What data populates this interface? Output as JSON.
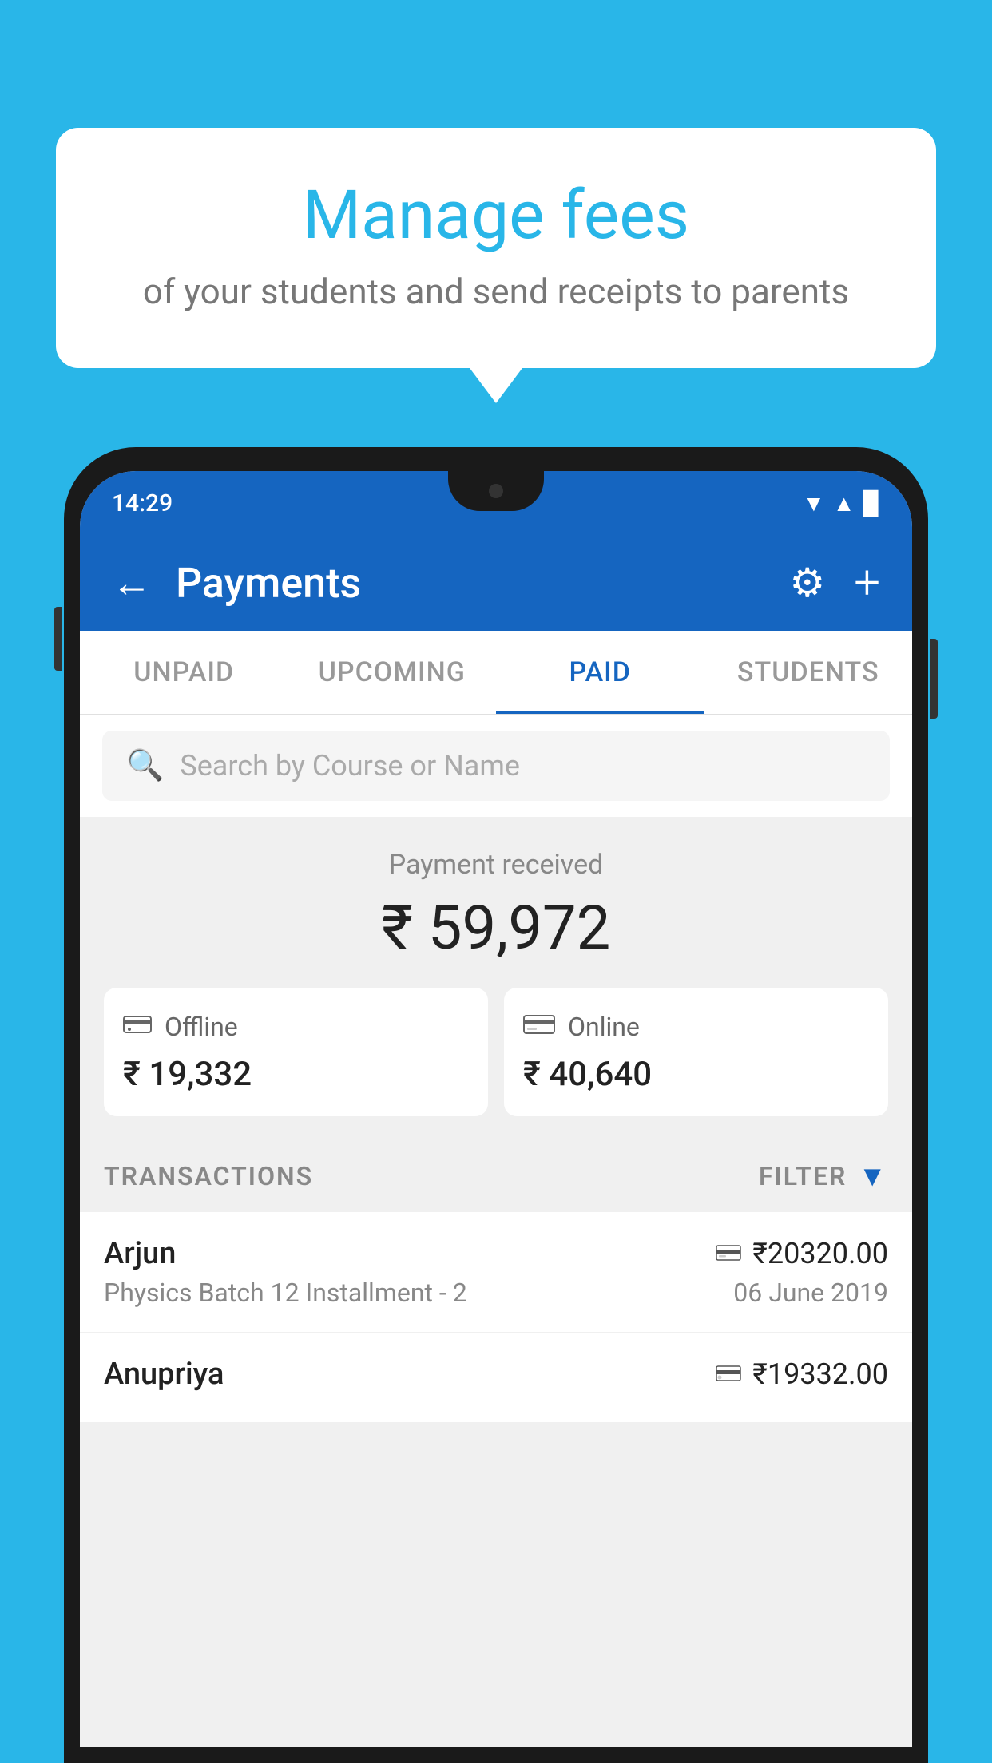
{
  "background_color": "#29b6e8",
  "bubble": {
    "title": "Manage fees",
    "subtitle": "of your students and send receipts to parents"
  },
  "status_bar": {
    "time": "14:29",
    "icons": [
      "▼",
      "▲",
      "▉"
    ]
  },
  "header": {
    "title": "Payments",
    "back_label": "←",
    "settings_icon": "⚙",
    "add_icon": "+"
  },
  "tabs": [
    {
      "label": "UNPAID",
      "active": false
    },
    {
      "label": "UPCOMING",
      "active": false
    },
    {
      "label": "PAID",
      "active": true
    },
    {
      "label": "STUDENTS",
      "active": false
    }
  ],
  "search": {
    "placeholder": "Search by Course or Name"
  },
  "payment_summary": {
    "label": "Payment received",
    "total": "₹ 59,972",
    "offline": {
      "icon": "💳",
      "label": "Offline",
      "amount": "₹ 19,332"
    },
    "online": {
      "icon": "💳",
      "label": "Online",
      "amount": "₹ 40,640"
    }
  },
  "transactions": {
    "section_label": "TRANSACTIONS",
    "filter_label": "FILTER",
    "rows": [
      {
        "name": "Arjun",
        "amount": "₹20320.00",
        "course": "Physics Batch 12 Installment - 2",
        "date": "06 June 2019",
        "payment_type": "online"
      },
      {
        "name": "Anupriya",
        "amount": "₹19332.00",
        "course": "",
        "date": "",
        "payment_type": "offline"
      }
    ]
  }
}
